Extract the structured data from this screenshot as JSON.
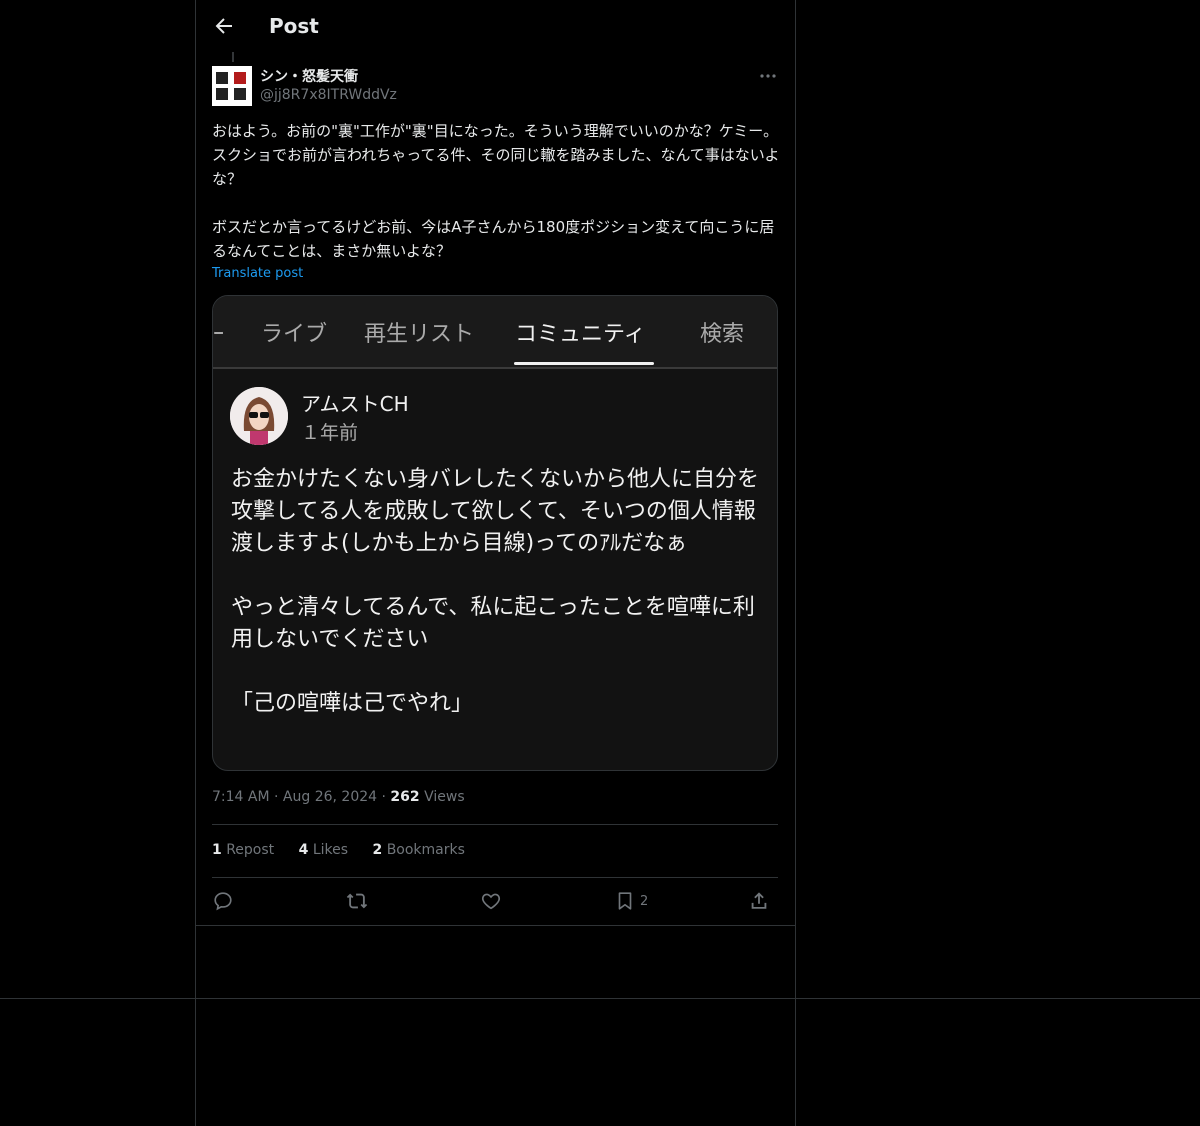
{
  "header": {
    "title": "Post"
  },
  "author": {
    "name": "シン・怒髪天衝",
    "handle": "@jj8R7x8ITRWddVz"
  },
  "post": {
    "paragraphs": [
      "おはよう。お前の\"裏\"工作が\"裏\"目になった。そういう理解でいいのかな？ケミー。スクショでお前が言われちゃってる件、その同じ轍を踏みました、なんて事はないよな？",
      "ボスだとか言ってるけどお前、今はA子さんから180度ポジション変えて向こうに居るなんてことは、まさか無いよな？"
    ],
    "translate_label": "Translate post"
  },
  "media": {
    "tabs": [
      "ライブ",
      "再生リスト",
      "コミュニティ",
      "検索"
    ],
    "active_tab": "コミュニティ",
    "community_post": {
      "author": "アムストCH",
      "time": "１年前",
      "paragraphs": [
        "お金かけたくない身バレしたくないから他人に自分を攻撃してる人を成敗して欲しくて、そいつの個人情報渡しますよ(しかも上から目線)ってのｱﾙだなぁ",
        "やっと清々してるんで、私に起こったことを喧嘩に利用しないでください",
        "「己の喧嘩は己でやれ」"
      ]
    }
  },
  "meta": {
    "time": "7:14 AM",
    "date": "Aug 26, 2024",
    "views": "262",
    "views_label": "Views"
  },
  "stats": {
    "reposts": "1",
    "reposts_label": "Repost",
    "likes": "4",
    "likes_label": "Likes",
    "bookmarks": "2",
    "bookmarks_label": "Bookmarks"
  },
  "actions": {
    "bookmark_count": "2"
  },
  "colors": {
    "accent": "#1d9bf0",
    "text": "#e7e9ea",
    "muted": "#71767b",
    "border": "#2f3336"
  }
}
